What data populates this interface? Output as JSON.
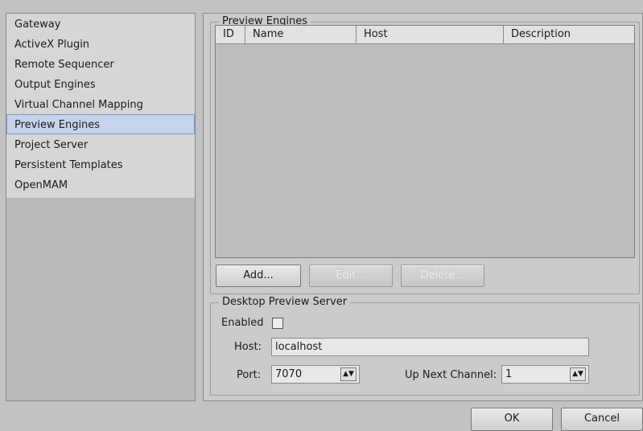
{
  "nav": {
    "items": [
      {
        "label": "Gateway"
      },
      {
        "label": "ActiveX Plugin"
      },
      {
        "label": "Remote Sequencer"
      },
      {
        "label": "Output Engines"
      },
      {
        "label": "Virtual Channel Mapping"
      },
      {
        "label": "Preview Engines",
        "selected": true
      },
      {
        "label": "Project Server"
      },
      {
        "label": "Persistent Templates"
      },
      {
        "label": "OpenMAM"
      }
    ]
  },
  "preview_engines": {
    "title": "Preview Engines",
    "columns": [
      "ID",
      "Name",
      "Host",
      "Description"
    ],
    "rows": [],
    "buttons": {
      "add": "Add...",
      "edit": "Edit...",
      "delete": "Delete..."
    }
  },
  "desktop_preview": {
    "title": "Desktop Preview Server",
    "enabled_label": "Enabled",
    "enabled": false,
    "host_label": "Host:",
    "host_value": "localhost",
    "port_label": "Port:",
    "port_value": "7070",
    "up_next_label": "Up Next Channel:",
    "up_next_value": "1"
  },
  "dialog": {
    "ok": "OK",
    "cancel": "Cancel"
  },
  "icons": {
    "spin": "spin-up-down-icon"
  }
}
